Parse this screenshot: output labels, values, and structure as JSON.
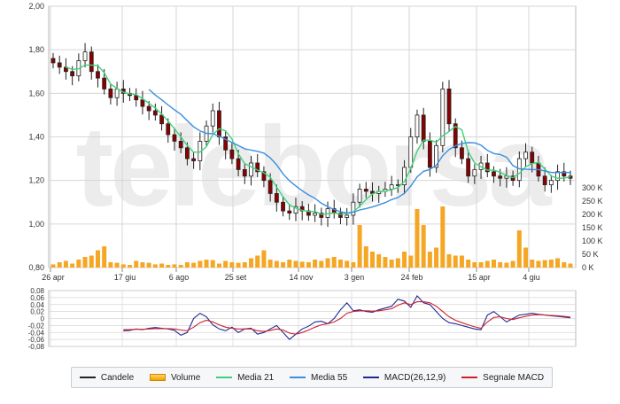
{
  "colors": {
    "candle_up": "#222222",
    "candle_down": "#8b0000",
    "volume": "#f5a623",
    "ma21": "#3fd27a",
    "ma55": "#3a8fe0",
    "macd": "#1f2a90",
    "signal": "#d0202a",
    "grid": "#d6d6d6",
    "watermark": "#ececec"
  },
  "watermark": "teleborsa",
  "chart_data": [
    {
      "type": "candlestick",
      "name": "price",
      "ylim": [
        0.8,
        2.0
      ],
      "y_ticks": [
        "2,00",
        "1,80",
        "1,60",
        "1,40",
        "1,20",
        "1,00",
        "0,80"
      ],
      "x_ticks": [
        "26 apr",
        "17 giu",
        "6 ago",
        "25 set",
        "14 nov",
        "3 gen",
        "24 feb",
        "15 apr",
        "4 giu"
      ],
      "close": [
        1.74,
        1.72,
        1.7,
        1.68,
        1.75,
        1.79,
        1.7,
        1.67,
        1.62,
        1.58,
        1.62,
        1.6,
        1.59,
        1.57,
        1.54,
        1.52,
        1.5,
        1.46,
        1.41,
        1.38,
        1.35,
        1.3,
        1.29,
        1.38,
        1.45,
        1.52,
        1.4,
        1.34,
        1.3,
        1.25,
        1.22,
        1.28,
        1.24,
        1.2,
        1.14,
        1.1,
        1.06,
        1.05,
        1.08,
        1.06,
        1.04,
        1.05,
        1.03,
        1.07,
        1.05,
        1.03,
        1.04,
        1.1,
        1.16,
        1.15,
        1.14,
        1.15,
        1.16,
        1.18,
        1.18,
        1.26,
        1.4,
        1.5,
        1.38,
        1.26,
        1.36,
        1.62,
        1.46,
        1.35,
        1.3,
        1.22,
        1.25,
        1.28,
        1.24,
        1.22,
        1.21,
        1.22,
        1.2,
        1.3,
        1.33,
        1.28,
        1.22,
        1.18,
        1.2,
        1.24,
        1.22,
        1.21
      ],
      "volume_axis": {
        "max": 300000,
        "ticks": [
          "300 K",
          "250 K",
          "200 K",
          "150 K",
          "100 K",
          "50 K",
          "0 K"
        ]
      },
      "volume": [
        12,
        20,
        25,
        15,
        30,
        40,
        45,
        65,
        80,
        20,
        18,
        12,
        10,
        25,
        20,
        18,
        12,
        15,
        10,
        12,
        10,
        20,
        18,
        25,
        30,
        28,
        15,
        25,
        20,
        18,
        20,
        35,
        45,
        65,
        30,
        25,
        20,
        30,
        25,
        22,
        20,
        30,
        25,
        35,
        40,
        30,
        25,
        20,
        160,
        80,
        60,
        50,
        40,
        30,
        35,
        60,
        45,
        220,
        160,
        60,
        75,
        230,
        50,
        45,
        45,
        30,
        20,
        20,
        25,
        30,
        20,
        18,
        25,
        140,
        75,
        30,
        25,
        28,
        30,
        35,
        20,
        15
      ]
    },
    {
      "type": "line",
      "name": "macd",
      "ylim": [
        -0.08,
        0.08
      ],
      "y_ticks": [
        "0,08",
        "0,06",
        "0,04",
        "0,02",
        "0",
        "-0,02",
        "-0,04",
        "-0,06",
        "-0,08"
      ],
      "series": [
        {
          "name": "MACD(26,12,9)",
          "start_index": 11,
          "values": [
            -0.035,
            -0.034,
            -0.03,
            -0.032,
            -0.028,
            -0.026,
            -0.028,
            -0.03,
            -0.034,
            -0.048,
            -0.04,
            0.0,
            0.015,
            0.005,
            -0.018,
            -0.03,
            -0.035,
            -0.025,
            -0.04,
            -0.03,
            -0.028,
            -0.045,
            -0.04,
            -0.03,
            -0.02,
            -0.04,
            -0.06,
            -0.045,
            -0.03,
            -0.022,
            -0.01,
            -0.008,
            -0.015,
            0.0,
            0.025,
            0.045,
            0.022,
            0.025,
            0.02,
            0.018,
            0.025,
            0.03,
            0.035,
            0.055,
            0.05,
            0.032,
            0.065,
            0.045,
            0.04,
            0.02,
            0.0,
            -0.012,
            -0.015,
            -0.02,
            -0.025,
            -0.03,
            -0.032,
            0.01,
            0.02,
            0.005,
            -0.01,
            0.0,
            0.01,
            0.012,
            0.015,
            0.012,
            0.01,
            0.008,
            0.006,
            0.004,
            0.002
          ]
        },
        {
          "name": "Segnale MACD",
          "start_index": 11,
          "values": [
            -0.032,
            -0.032,
            -0.031,
            -0.031,
            -0.03,
            -0.029,
            -0.029,
            -0.029,
            -0.03,
            -0.033,
            -0.035,
            -0.025,
            -0.012,
            -0.005,
            -0.01,
            -0.018,
            -0.025,
            -0.028,
            -0.03,
            -0.03,
            -0.03,
            -0.035,
            -0.037,
            -0.034,
            -0.03,
            -0.033,
            -0.042,
            -0.045,
            -0.04,
            -0.033,
            -0.025,
            -0.018,
            -0.015,
            -0.01,
            0.0,
            0.015,
            0.02,
            0.022,
            0.022,
            0.021,
            0.022,
            0.025,
            0.028,
            0.038,
            0.045,
            0.04,
            0.048,
            0.048,
            0.045,
            0.035,
            0.02,
            0.005,
            -0.005,
            -0.012,
            -0.018,
            -0.024,
            -0.028,
            -0.01,
            0.003,
            0.005,
            0.0,
            -0.003,
            0.002,
            0.006,
            0.01,
            0.011,
            0.01,
            0.009,
            0.008,
            0.006,
            0.004
          ]
        }
      ]
    }
  ],
  "legend": [
    {
      "key": "candles",
      "label": "Candele"
    },
    {
      "key": "volume",
      "label": "Volume"
    },
    {
      "key": "ma21",
      "label": "Media 21"
    },
    {
      "key": "ma55",
      "label": "Media 55"
    },
    {
      "key": "macd",
      "label": "MACD(26,12,9)"
    },
    {
      "key": "signal",
      "label": "Segnale MACD"
    }
  ]
}
